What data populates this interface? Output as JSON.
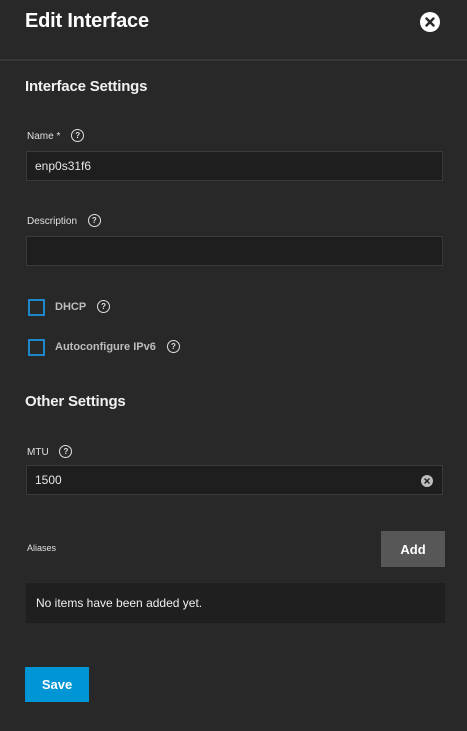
{
  "dialog": {
    "title": "Edit Interface"
  },
  "interface_settings": {
    "heading": "Interface Settings",
    "name": {
      "label": "Name",
      "required_mark": "*",
      "value": "enp0s31f6"
    },
    "description": {
      "label": "Description",
      "value": ""
    },
    "dhcp": {
      "label": "DHCP",
      "checked": false
    },
    "autoconfigure_ipv6": {
      "label": "Autoconfigure IPv6",
      "checked": false
    }
  },
  "other_settings": {
    "heading": "Other Settings",
    "mtu": {
      "label": "MTU",
      "value": "1500"
    }
  },
  "aliases": {
    "label": "Aliases",
    "add_label": "Add",
    "empty_text": "No items have been added yet."
  },
  "footer": {
    "save_label": "Save"
  },
  "colors": {
    "background": "#282828",
    "input_background": "#1e1e1e",
    "accent": "#0095d5",
    "checkbox_border": "#1d87c9",
    "add_button": "#575757"
  }
}
